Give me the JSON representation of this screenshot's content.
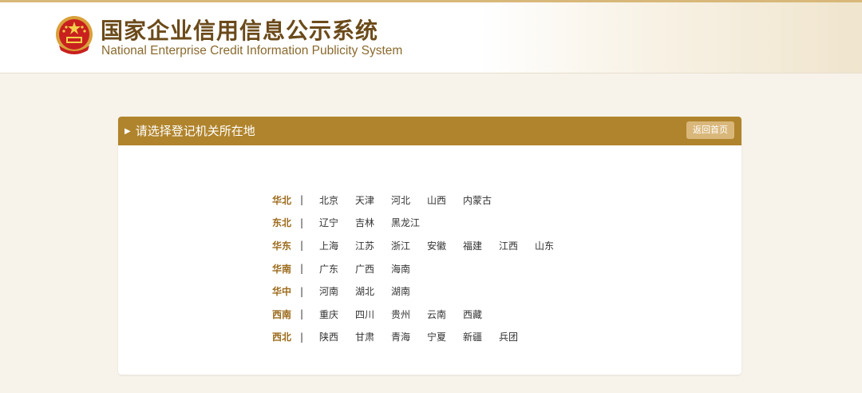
{
  "header": {
    "title_cn": "国家企业信用信息公示系统",
    "title_en": "National Enterprise Credit Information Publicity System"
  },
  "panel": {
    "title": "请选择登记机关所在地",
    "back_label": "返回首页"
  },
  "separator": "|",
  "regions": [
    {
      "name": "华北",
      "provinces": [
        "北京",
        "天津",
        "河北",
        "山西",
        "内蒙古"
      ]
    },
    {
      "name": "东北",
      "provinces": [
        "辽宁",
        "吉林",
        "黑龙江"
      ]
    },
    {
      "name": "华东",
      "provinces": [
        "上海",
        "江苏",
        "浙江",
        "安徽",
        "福建",
        "江西",
        "山东"
      ]
    },
    {
      "name": "华南",
      "provinces": [
        "广东",
        "广西",
        "海南"
      ]
    },
    {
      "name": "华中",
      "provinces": [
        "河南",
        "湖北",
        "湖南"
      ]
    },
    {
      "name": "西南",
      "provinces": [
        "重庆",
        "四川",
        "贵州",
        "云南",
        "西藏"
      ]
    },
    {
      "name": "西北",
      "provinces": [
        "陕西",
        "甘肃",
        "青海",
        "宁夏",
        "新疆",
        "兵团"
      ]
    }
  ]
}
